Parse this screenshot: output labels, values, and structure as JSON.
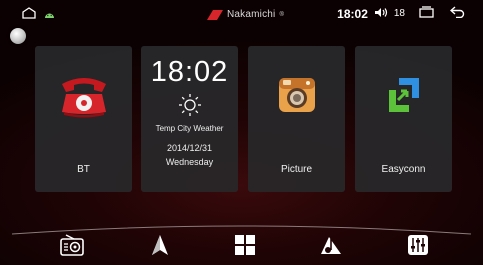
{
  "status": {
    "time": "18:02",
    "volume": "18",
    "brand": "Nakamichi",
    "brand_mark": "®",
    "icons": [
      "home-outline-icon",
      "android-notification-icon",
      "speaker-icon",
      "recent-apps-icon",
      "back-arrow-icon"
    ]
  },
  "tiles": {
    "bt": {
      "label": "BT",
      "icon": "red-telephone-icon"
    },
    "clock": {
      "time": "18:02",
      "weather": "Temp City Weather",
      "date": "2014/12/31",
      "weekday": "Wednesday",
      "icon": "sun-icon"
    },
    "picture": {
      "label": "Picture",
      "icon": "camera-icon"
    },
    "easyconn": {
      "label": "Easyconn",
      "icon": "easyconn-icon"
    }
  },
  "dock": {
    "items": [
      "radio-icon",
      "navigation-icon",
      "apps-grid-icon",
      "music-icon",
      "equalizer-icon"
    ]
  },
  "colors": {
    "background": "#200405",
    "accent_red": "#d7262b",
    "tile": "#28282a",
    "easyconn_green": "#5cc23a",
    "easyconn_blue": "#2f8fe0"
  }
}
